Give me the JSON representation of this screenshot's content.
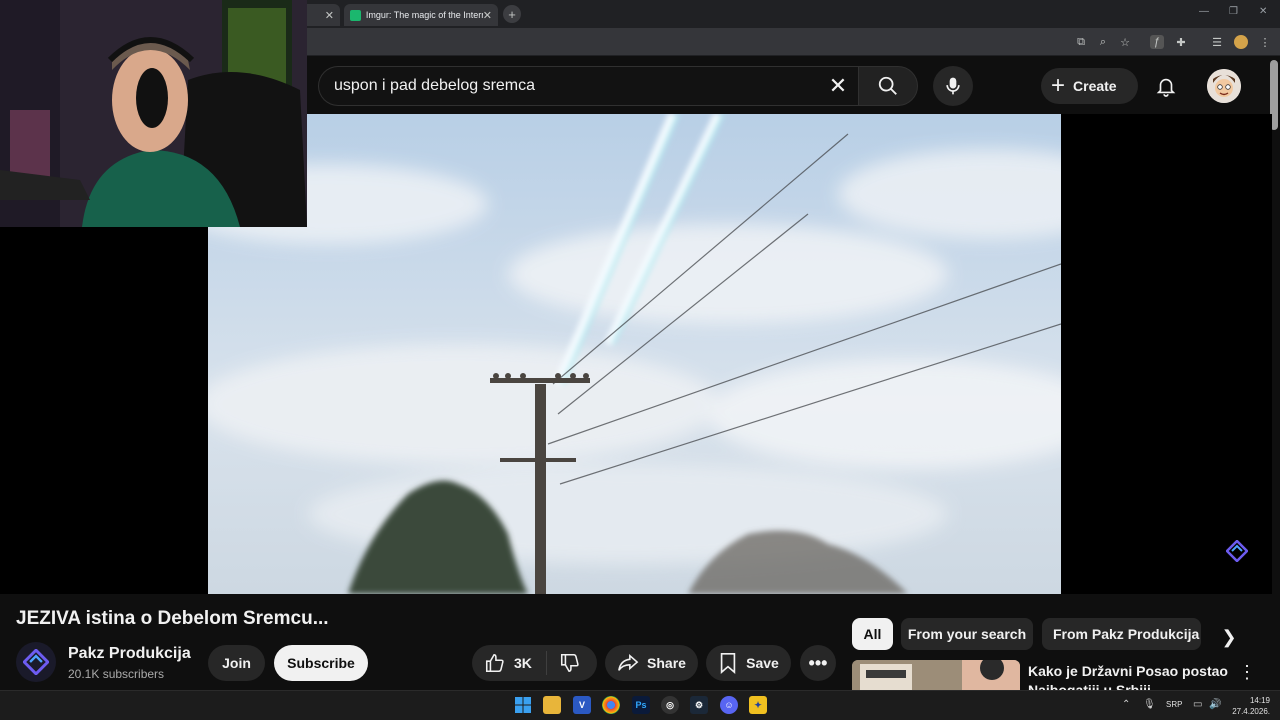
{
  "browser": {
    "tabs": [
      {
        "label": ""
      },
      {
        "label": "Imgur: The magic of the Internet"
      }
    ],
    "new_tab": "+"
  },
  "header": {
    "search_query": "uspon i pad debelog sremca",
    "create_label": "Create"
  },
  "video": {
    "title": "JEZIVA istina o Debelom Sremcu...",
    "channel_name": "Pakz Produkcija",
    "subscribers": "20.1K subscribers",
    "join_label": "Join",
    "subscribe_label": "Subscribe",
    "likes": "3K",
    "share_label": "Share",
    "save_label": "Save"
  },
  "related": {
    "chips": [
      "All",
      "From your search",
      "From Pakz Produkcija"
    ],
    "first_title": "Kako je Državni Posao postao Najbogatiji u Srbiji..."
  },
  "taskbar": {
    "language": "SRP",
    "time": "14:19",
    "date": "27.4.2026."
  },
  "colors": {
    "background": "#0f0f0f",
    "chip_active": "#f1f1f1",
    "button_bg": "#272727"
  }
}
